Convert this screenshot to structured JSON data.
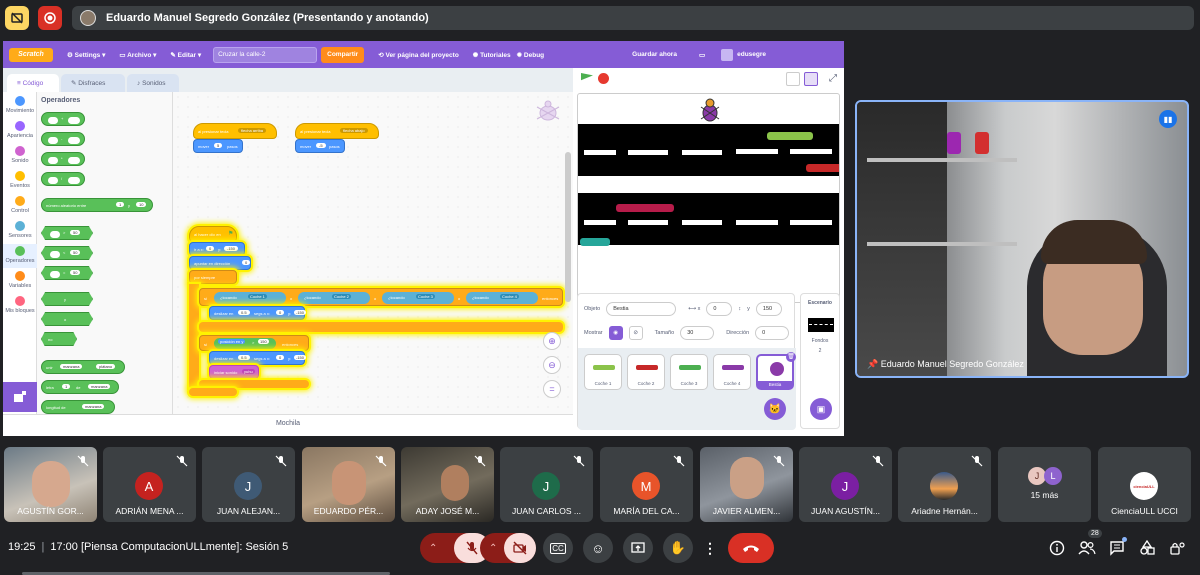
{
  "topbar": {
    "presenter_text": "Eduardo Manuel Segredo González (Presentando y anotando)"
  },
  "scratch": {
    "logo": "Scratch",
    "menu": [
      "Settings",
      "Archivo",
      "Editar"
    ],
    "project_name": "Cruzar la calle-2",
    "share_label": "Compartir",
    "see_project": "Ver página del proyecto",
    "tutorials": "Tutoriales",
    "debug": "Debug",
    "save_now": "Guardar ahora",
    "username": "edusegre",
    "tabs": [
      "Código",
      "Disfraces",
      "Sonidos"
    ],
    "categories": [
      {
        "label": "Movimiento",
        "color": "#4c97ff"
      },
      {
        "label": "Apariencia",
        "color": "#9966ff"
      },
      {
        "label": "Sonido",
        "color": "#cf63cf"
      },
      {
        "label": "Eventos",
        "color": "#ffbf00"
      },
      {
        "label": "Control",
        "color": "#ffab19"
      },
      {
        "label": "Sensores",
        "color": "#5cb1d6"
      },
      {
        "label": "Operadores",
        "color": "#59c059"
      },
      {
        "label": "Variables",
        "color": "#ff8c1a"
      },
      {
        "label": "Mis bloques",
        "color": "#ff6680"
      }
    ],
    "palette_title": "Operadores",
    "palette": {
      "random": "número aleatorio entre",
      "random_a": "1",
      "random_b": "10",
      "gt": "50",
      "lt": "50",
      "eq": "50",
      "and": "y",
      "or": "o",
      "not": "no",
      "join": "unir",
      "join_a": "manzana",
      "join_b": "plátano",
      "letter": "letra",
      "letter_n": "1",
      "letter_of": "de",
      "letter_word": "manzana",
      "length": "longitud de",
      "length_word": "manzana"
    },
    "code": {
      "key1": "al presionar tecla",
      "key1_val": "flecha arriba",
      "move1": "mover",
      "move1_val": "5",
      "steps1": "pasos",
      "key2": "al presionar tecla",
      "key2_val": "flecha abajo",
      "move2": "mover",
      "move2_val": "-5",
      "steps2": "pasos",
      "flag_click": "al hacer clic en",
      "goto_x": "ir a x:",
      "goto_x_val": "0",
      "goto_y": "y:",
      "goto_y_val": "-150",
      "point_dir": "apuntar en dirección",
      "point_dir_val": "0",
      "forever": "por siempre",
      "if1": "si",
      "touching": "¿tocando",
      "car1": "Coche 1",
      "car2": "Coche 2",
      "car3": "Coche 3",
      "car4": "Coche 4",
      "or": "o",
      "then": "entonces",
      "glide": "deslizar en",
      "glide_val": "0.5",
      "secs_to_x": "segs a x:",
      "glide_x": "0",
      "glide_y_label": "y:",
      "glide_y": "-150",
      "if2": "si",
      "pos_y": "posición en y",
      "gt_val": "150",
      "then2": "entonces",
      "glide2": "deslizar en",
      "glide2_val": "0.5",
      "secs2": "segs a x:",
      "glide2_x": "0",
      "glide2_y_label": "y:",
      "glide2_y": "-150",
      "sound": "iniciar sonido",
      "sound_val": "yuhu"
    },
    "backpack": "Mochila",
    "sprite_info": {
      "sprite_label": "Objeto",
      "sprite_name": "Bestia",
      "x_val": "0",
      "y_label": "y",
      "y_val": "150",
      "show_label": "Mostrar",
      "size_label": "Tamaño",
      "size_val": "30",
      "direction_label": "Dirección",
      "direction_val": "0"
    },
    "sprites": [
      "Coche 1",
      "Coche 2",
      "Coche 3",
      "Coche 4",
      "Bestia"
    ],
    "stage_panel": {
      "title": "Escenario",
      "backdrops_label": "Fondos",
      "backdrops_count": "2"
    }
  },
  "webcam": {
    "name": "Eduardo Manuel Segredo González"
  },
  "participants": [
    {
      "name": "AGUSTÍN GOR...",
      "type": "video"
    },
    {
      "name": "ADRIÁN MENA ...",
      "type": "avatar",
      "initial": "A",
      "color": "#c5221f"
    },
    {
      "name": "JUAN ALEJAN...",
      "type": "avatar",
      "initial": "J",
      "color": "#3f5a75"
    },
    {
      "name": "EDUARDO PÉR...",
      "type": "video"
    },
    {
      "name": "ADAY JOSÉ M...",
      "type": "video"
    },
    {
      "name": "JUAN CARLOS ...",
      "type": "avatar",
      "initial": "J",
      "color": "#1e6b4a"
    },
    {
      "name": "MARÍA DEL CA...",
      "type": "avatar",
      "initial": "M",
      "color": "#e8542a"
    },
    {
      "name": "JAVIER ALMEN...",
      "type": "video"
    },
    {
      "name": "JUAN AGUSTÍN...",
      "type": "avatar",
      "initial": "J",
      "color": "#7b1fa2"
    },
    {
      "name": "Ariadne Hernán...",
      "type": "photo"
    },
    {
      "name": "15 más",
      "type": "more"
    },
    {
      "name": "CienciaULL UCCI",
      "type": "logo"
    }
  ],
  "bottom": {
    "time": "19:25",
    "meeting": "17:00 [Piensa ComputacionULLmente]: Sesión 5",
    "participants_count": "28"
  }
}
